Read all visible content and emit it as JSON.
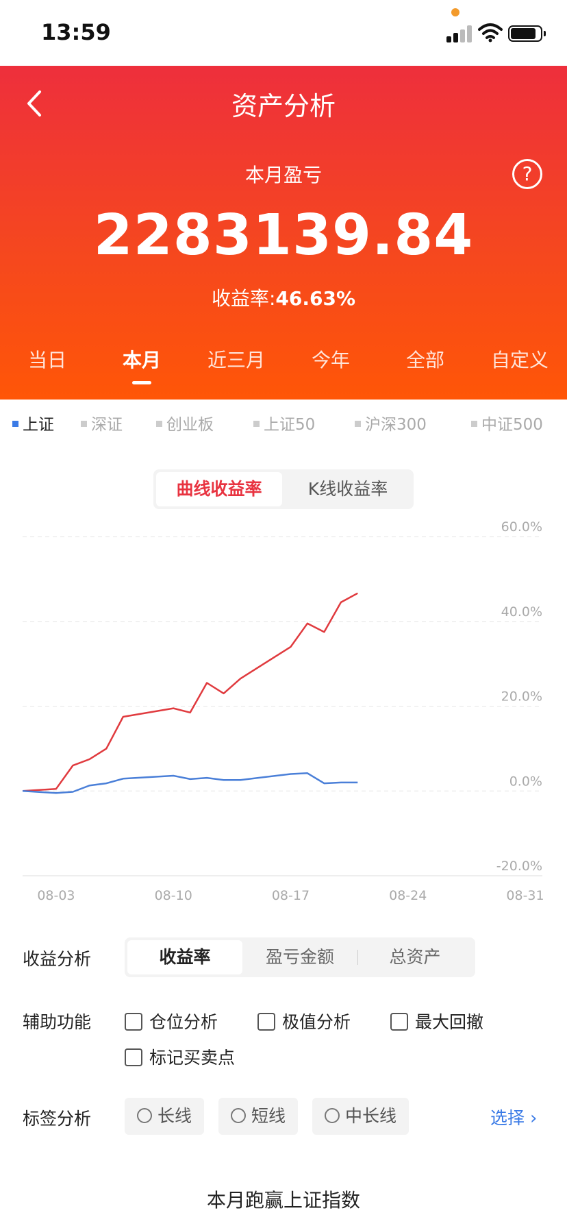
{
  "status_bar": {
    "time": "13:59"
  },
  "header": {
    "title": "资产分析",
    "period_label": "本月盈亏",
    "profit_value": "2283139.84",
    "rate_label": "收益率:",
    "rate_value": "46.63%",
    "help_symbol": "?"
  },
  "period_tabs": [
    {
      "label": "当日",
      "active": false
    },
    {
      "label": "本月",
      "active": true
    },
    {
      "label": "近三月",
      "active": false
    },
    {
      "label": "今年",
      "active": false
    },
    {
      "label": "全部",
      "active": false
    },
    {
      "label": "自定义",
      "active": false
    }
  ],
  "index_filters": [
    {
      "label": "上证",
      "active": true
    },
    {
      "label": "深证",
      "active": false
    },
    {
      "label": "创业板",
      "active": false
    },
    {
      "label": "上证50",
      "active": false
    },
    {
      "label": "沪深300",
      "active": false
    },
    {
      "label": "中证500",
      "active": false
    }
  ],
  "chart_toggle": [
    {
      "label": "曲线收益率",
      "active": true
    },
    {
      "label": "K线收益率",
      "active": false
    }
  ],
  "chart_data": {
    "type": "line",
    "xlabel": "",
    "ylabel": "",
    "x_tick_labels": [
      "08-03",
      "08-10",
      "08-17",
      "08-24",
      "08-31"
    ],
    "y_tick_labels": [
      "60.0%",
      "40.0%",
      "20.0%",
      "0.0%",
      "-20.0%"
    ],
    "ylim": [
      -20,
      60
    ],
    "xlim": [
      "08-01",
      "08-31"
    ],
    "grid": true,
    "series": [
      {
        "color": "#e03a3e",
        "points": [
          [
            "08-01",
            0.0
          ],
          [
            "08-03",
            0.5
          ],
          [
            "08-04",
            6.0
          ],
          [
            "08-05",
            7.5
          ],
          [
            "08-06",
            10.0
          ],
          [
            "08-07",
            17.5
          ],
          [
            "08-10",
            19.5
          ],
          [
            "08-11",
            18.5
          ],
          [
            "08-12",
            25.5
          ],
          [
            "08-13",
            23.0
          ],
          [
            "08-14",
            26.5
          ],
          [
            "08-17",
            34.0
          ],
          [
            "08-18",
            39.5
          ],
          [
            "08-19",
            37.5
          ],
          [
            "08-20",
            44.5
          ],
          [
            "08-21",
            46.63
          ]
        ]
      },
      {
        "color": "#4a7fd8",
        "points": [
          [
            "08-01",
            0.0
          ],
          [
            "08-03",
            -0.5
          ],
          [
            "08-04",
            -0.2
          ],
          [
            "08-05",
            1.3
          ],
          [
            "08-06",
            1.8
          ],
          [
            "08-07",
            2.9
          ],
          [
            "08-10",
            3.6
          ],
          [
            "08-11",
            2.8
          ],
          [
            "08-12",
            3.1
          ],
          [
            "08-13",
            2.6
          ],
          [
            "08-14",
            2.6
          ],
          [
            "08-17",
            4.0
          ],
          [
            "08-18",
            4.2
          ],
          [
            "08-19",
            1.8
          ],
          [
            "08-20",
            2.0
          ],
          [
            "08-21",
            2.0
          ]
        ]
      }
    ]
  },
  "profit_analysis": {
    "label": "收益分析",
    "options": [
      {
        "label": "收益率",
        "active": true
      },
      {
        "label": "盈亏金额",
        "active": false
      },
      {
        "label": "总资产",
        "active": false
      }
    ]
  },
  "aux_functions": {
    "label": "辅助功能",
    "items": [
      "仓位分析",
      "极值分析",
      "最大回撤",
      "标记买卖点"
    ]
  },
  "tag_analysis": {
    "label": "标签分析",
    "tags": [
      "长线",
      "短线",
      "中长线"
    ],
    "select_label": "选择"
  },
  "footer_title": "本月跑赢上证指数"
}
